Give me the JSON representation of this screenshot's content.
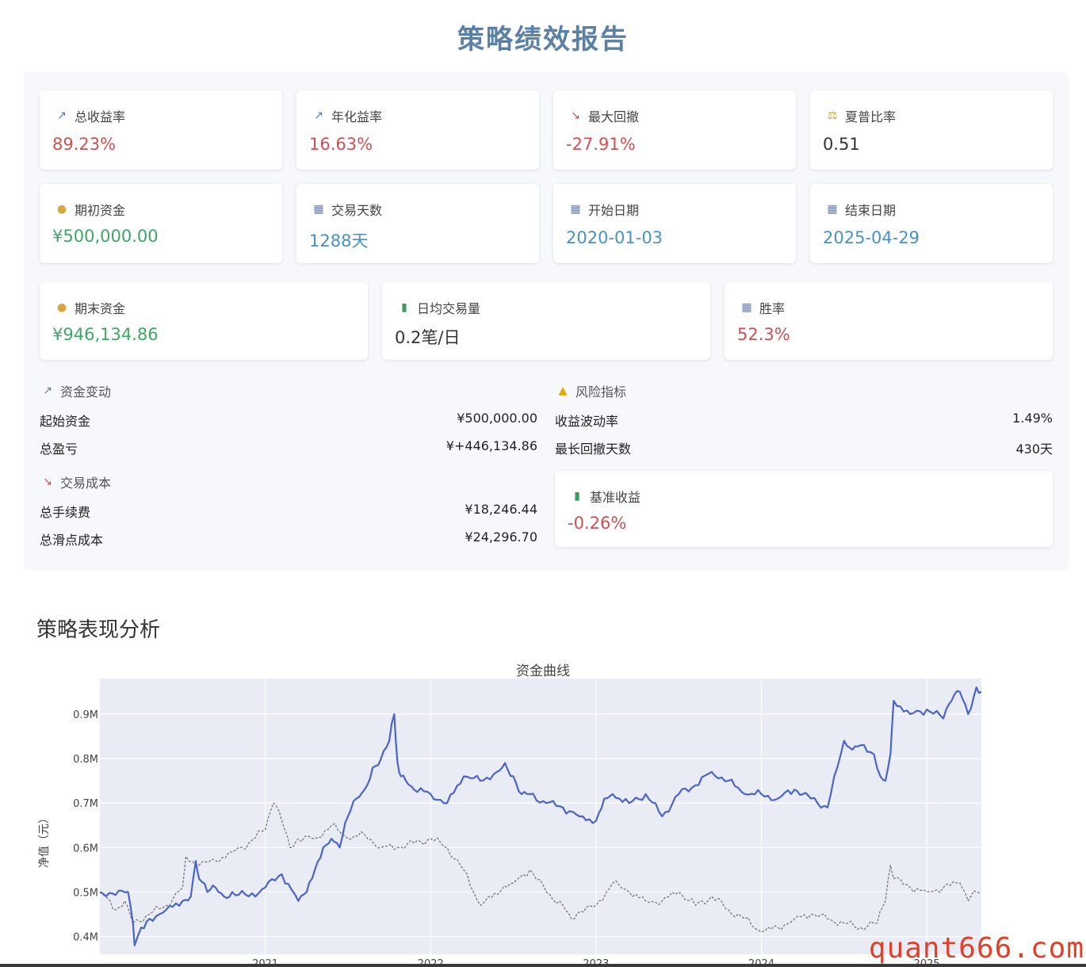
{
  "title": "策略绩效报告",
  "metrics": [
    {
      "label": "总收益率",
      "value": "89.23%",
      "icon": "chart-up-icon"
    },
    {
      "label": "年化益率",
      "value": "16.63%",
      "icon": "chart-up-icon"
    },
    {
      "label": "最大回撤",
      "value": "-27.91%",
      "icon": "chart-down-icon"
    },
    {
      "label": "夏普比率",
      "value": "0.51",
      "icon": "scale-icon"
    },
    {
      "label": "期初资金",
      "value": "¥500,000.00",
      "icon": "money-bag-icon"
    },
    {
      "label": "交易天数",
      "value": "1288天",
      "icon": "calendar-icon"
    },
    {
      "label": "开始日期",
      "value": "2020-01-03",
      "icon": "calendar-icon"
    },
    {
      "label": "结束日期",
      "value": "2025-04-29",
      "icon": "calendar-icon"
    },
    {
      "label": "期末资金",
      "value": "¥946,134.86",
      "icon": "money-bag-icon"
    },
    {
      "label": "日均交易量",
      "value": "0.2笔/日",
      "icon": "bar-chart-icon"
    },
    {
      "label": "胜率",
      "value": "52.3%",
      "icon": "calendar-icon"
    }
  ],
  "capital": {
    "heading": "资金变动",
    "rows": [
      {
        "key": "起始资金",
        "value": "¥500,000.00"
      },
      {
        "key": "总盈亏",
        "value": "¥+446,134.86"
      }
    ]
  },
  "costs": {
    "heading": "交易成本",
    "rows": [
      {
        "key": "总手续费",
        "value": "¥18,246.44"
      },
      {
        "key": "总滑点成本",
        "value": "¥24,296.70"
      }
    ]
  },
  "risk": {
    "heading": "风险指标",
    "rows": [
      {
        "key": "收益波动率",
        "value": "1.49%"
      },
      {
        "key": "最长回撤天数",
        "value": "430天"
      }
    ]
  },
  "benchmark": {
    "label": "基准收益",
    "value": "-0.26%"
  },
  "analysis_title": "策略表现分析",
  "chart_data": {
    "type": "line",
    "title": "资金曲线",
    "ylabel": "净值（元）",
    "xlabel": "",
    "ylim": [
      0.36,
      0.98
    ],
    "xlim": [
      2020.0,
      2025.33
    ],
    "yticks": [
      {
        "value": 0.4,
        "label": "0.4M"
      },
      {
        "value": 0.5,
        "label": "0.5M"
      },
      {
        "value": 0.6,
        "label": "0.6M"
      },
      {
        "value": 0.7,
        "label": "0.7M"
      },
      {
        "value": 0.8,
        "label": "0.8M"
      },
      {
        "value": 0.9,
        "label": "0.9M"
      }
    ],
    "xticks": [
      {
        "value": 2021,
        "label": "2021"
      },
      {
        "value": 2022,
        "label": "2022"
      },
      {
        "value": 2023,
        "label": "2023"
      },
      {
        "value": 2024,
        "label": "2024"
      },
      {
        "value": 2025,
        "label": "2025"
      }
    ],
    "unit": "M (元)",
    "series": [
      {
        "style": "solid",
        "color": "#4a64c8",
        "x": [
          2020.0,
          2020.17,
          2020.2,
          2020.21,
          2020.25,
          2020.3,
          2020.4,
          2020.5,
          2020.55,
          2020.58,
          2020.6,
          2020.65,
          2020.7,
          2020.75,
          2020.8,
          2020.9,
          2021.0,
          2021.1,
          2021.2,
          2021.25,
          2021.3,
          2021.35,
          2021.4,
          2021.45,
          2021.5,
          2021.55,
          2021.6,
          2021.65,
          2021.7,
          2021.75,
          2021.78,
          2021.8,
          2021.82,
          2021.85,
          2021.9,
          2022.0,
          2022.1,
          2022.2,
          2022.3,
          2022.4,
          2022.45,
          2022.5,
          2022.55,
          2022.6,
          2022.7,
          2022.8,
          2022.9,
          2023.0,
          2023.05,
          2023.1,
          2023.2,
          2023.3,
          2023.4,
          2023.5,
          2023.6,
          2023.7,
          2023.8,
          2023.9,
          2024.0,
          2024.1,
          2024.2,
          2024.25,
          2024.3,
          2024.4,
          2024.5,
          2024.55,
          2024.6,
          2024.68,
          2024.72,
          2024.75,
          2024.78,
          2024.8,
          2024.9,
          2025.0,
          2025.1,
          2025.15,
          2025.2,
          2025.25,
          2025.3,
          2025.33
        ],
        "y": [
          0.5,
          0.5,
          0.43,
          0.38,
          0.42,
          0.44,
          0.46,
          0.48,
          0.49,
          0.57,
          0.53,
          0.5,
          0.51,
          0.49,
          0.5,
          0.49,
          0.51,
          0.54,
          0.48,
          0.5,
          0.55,
          0.6,
          0.62,
          0.6,
          0.67,
          0.71,
          0.73,
          0.78,
          0.8,
          0.84,
          0.9,
          0.79,
          0.76,
          0.75,
          0.73,
          0.72,
          0.7,
          0.76,
          0.75,
          0.77,
          0.79,
          0.76,
          0.72,
          0.72,
          0.7,
          0.69,
          0.67,
          0.66,
          0.71,
          0.72,
          0.7,
          0.72,
          0.67,
          0.72,
          0.74,
          0.77,
          0.75,
          0.72,
          0.72,
          0.71,
          0.73,
          0.72,
          0.71,
          0.69,
          0.84,
          0.82,
          0.83,
          0.81,
          0.76,
          0.75,
          0.81,
          0.93,
          0.9,
          0.91,
          0.89,
          0.93,
          0.95,
          0.9,
          0.96,
          0.95
        ]
      },
      {
        "style": "dashed",
        "color": "#777777",
        "x": [
          2020.0,
          2020.1,
          2020.15,
          2020.2,
          2020.3,
          2020.4,
          2020.5,
          2020.52,
          2020.6,
          2020.7,
          2020.8,
          2020.9,
          2021.0,
          2021.05,
          2021.1,
          2021.15,
          2021.2,
          2021.3,
          2021.4,
          2021.5,
          2021.6,
          2021.7,
          2021.8,
          2021.9,
          2022.0,
          2022.1,
          2022.2,
          2022.3,
          2022.35,
          2022.5,
          2022.6,
          2022.7,
          2022.8,
          2022.85,
          2023.0,
          2023.1,
          2023.2,
          2023.3,
          2023.4,
          2023.5,
          2023.6,
          2023.7,
          2023.8,
          2023.9,
          2024.0,
          2024.1,
          2024.2,
          2024.3,
          2024.4,
          2024.5,
          2024.6,
          2024.7,
          2024.75,
          2024.78,
          2024.8,
          2024.9,
          2025.0,
          2025.1,
          2025.2,
          2025.25,
          2025.3,
          2025.33
        ],
        "y": [
          0.5,
          0.46,
          0.48,
          0.43,
          0.45,
          0.47,
          0.51,
          0.58,
          0.56,
          0.57,
          0.59,
          0.61,
          0.64,
          0.7,
          0.66,
          0.6,
          0.62,
          0.62,
          0.65,
          0.62,
          0.63,
          0.6,
          0.6,
          0.61,
          0.62,
          0.6,
          0.55,
          0.47,
          0.49,
          0.52,
          0.55,
          0.5,
          0.47,
          0.44,
          0.47,
          0.52,
          0.5,
          0.48,
          0.48,
          0.5,
          0.47,
          0.49,
          0.46,
          0.44,
          0.41,
          0.42,
          0.44,
          0.45,
          0.44,
          0.43,
          0.42,
          0.43,
          0.48,
          0.56,
          0.53,
          0.51,
          0.5,
          0.51,
          0.52,
          0.48,
          0.5,
          0.5
        ]
      }
    ]
  }
}
